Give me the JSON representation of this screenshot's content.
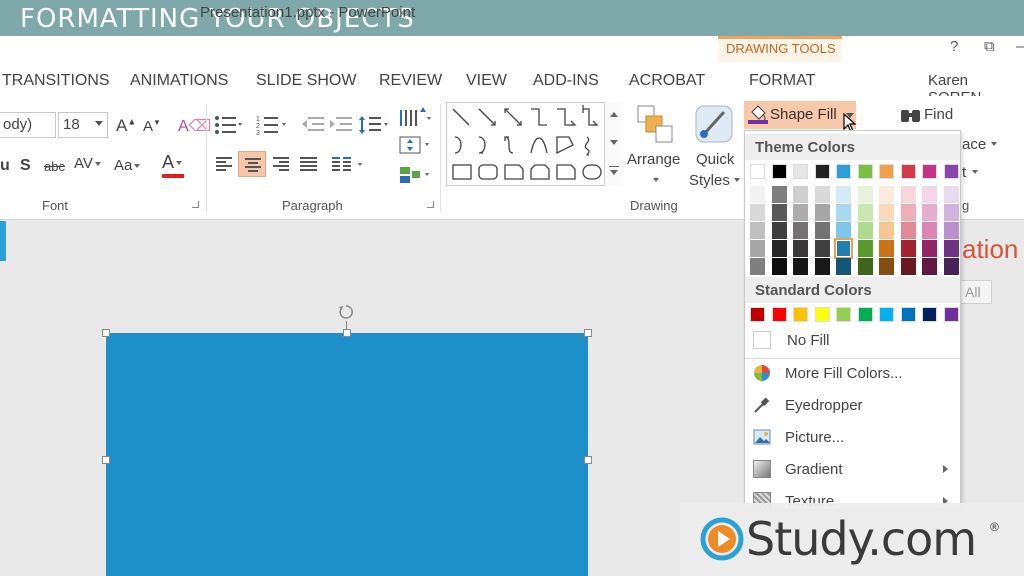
{
  "banner": {
    "title": "FORMATTING YOUR OBJECTS"
  },
  "window": {
    "title": "Presentation1.pptx - PowerPoint",
    "context_group": "DRAWING TOOLS",
    "help": "?",
    "restore": "⧉",
    "minimize": "—"
  },
  "tabs": [
    "TRANSITIONS",
    "ANIMATIONS",
    "SLIDE SHOW",
    "REVIEW",
    "VIEW",
    "ADD-INS",
    "ACROBAT",
    "FORMAT"
  ],
  "user": {
    "name": "Karen SOREN"
  },
  "ribbon": {
    "font_name": "ody)",
    "font_size": "18",
    "groups": {
      "font": "Font",
      "paragraph": "Paragraph",
      "drawing": "Drawing"
    },
    "arrange": "Arrange",
    "quick_styles_1": "Quick",
    "quick_styles_2": "Styles",
    "shape_fill": "Shape Fill",
    "find": "Find",
    "replace_frag": "ace",
    "select_frag": "t",
    "editing_frag": "g"
  },
  "fill_menu": {
    "theme_header": "Theme Colors",
    "standard_header": "Standard Colors",
    "theme_top": [
      "#ffffff",
      "#000000",
      "#e7e6e6",
      "#222222",
      "#2e9fd6",
      "#7ac143",
      "#f0a04b",
      "#d03a4a",
      "#c23488",
      "#8e44ad"
    ],
    "theme_shades": [
      [
        "#f2f2f2",
        "#d9d9d9",
        "#bfbfbf",
        "#a6a6a6",
        "#7f7f7f"
      ],
      [
        "#7f7f7f",
        "#595959",
        "#3f3f3f",
        "#262626",
        "#0d0d0d"
      ],
      [
        "#d0cece",
        "#aeabab",
        "#757171",
        "#3a3838",
        "#171616"
      ],
      [
        "#d9d9d9",
        "#a6a6a6",
        "#737373",
        "#404040",
        "#191919"
      ],
      [
        "#d4ecf8",
        "#a9d9f1",
        "#7ec6ea",
        "#1f7fb0",
        "#155575"
      ],
      [
        "#e4f3d9",
        "#c9e7b3",
        "#afdb8e",
        "#5b9a2c",
        "#3d671d"
      ],
      [
        "#fcecdb",
        "#f9d9b7",
        "#f6c693",
        "#c8731a",
        "#854d11"
      ],
      [
        "#f6d8db",
        "#edb0b7",
        "#e38994",
        "#a0232f",
        "#6b171f"
      ],
      [
        "#f3d6e7",
        "#e7adcf",
        "#db85b7",
        "#922566",
        "#611944"
      ],
      [
        "#e8daef",
        "#d2b4de",
        "#bb8fce",
        "#6c3483",
        "#48235a"
      ]
    ],
    "selected_swatch": {
      "col": 4,
      "row": 3
    },
    "standard": [
      "#c00000",
      "#ff0000",
      "#ffc000",
      "#ffff00",
      "#92d050",
      "#00b050",
      "#00b0f0",
      "#0070c0",
      "#002060",
      "#7030a0"
    ],
    "items": {
      "no_fill": "No Fill",
      "more_colors": "More Fill Colors...",
      "eyedropper": "Eyedropper",
      "picture": "Picture...",
      "gradient": "Gradient",
      "texture": "Texture"
    }
  },
  "slide": {
    "title_fragment": "ation",
    "select_all_fragment": "All",
    "shape_color": "#1e90c9"
  },
  "logo": {
    "text": "Study.com",
    "registered": "®"
  }
}
